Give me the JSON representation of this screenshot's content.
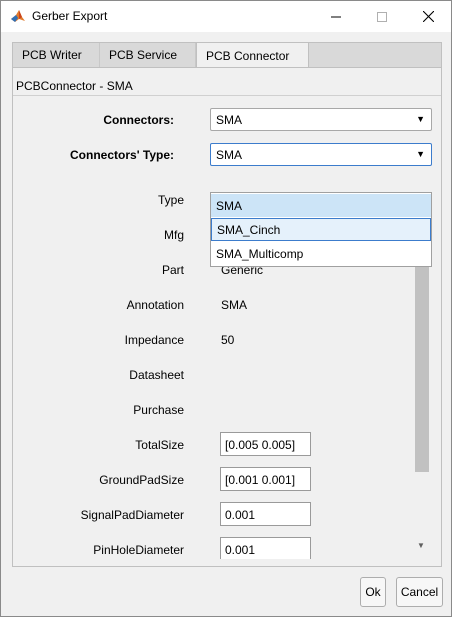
{
  "window": {
    "title": "Gerber Export",
    "minimize_glyph": "—",
    "maximize_glyph": "☐",
    "close_glyph": "✕"
  },
  "tabs": [
    {
      "label": "PCB Writer",
      "active": false
    },
    {
      "label": "PCB Service",
      "active": false
    },
    {
      "label": "PCB Connector",
      "active": true
    }
  ],
  "panel": {
    "title": "PCBConnector - SMA",
    "connectors_label": "Connectors:",
    "connectors_value": "SMA",
    "type_label": "Connectors' Type:",
    "type_value": "SMA",
    "type_options": [
      "SMA",
      "SMA_Cinch",
      "SMA_Multicomp"
    ],
    "properties": {
      "type_label": "Type",
      "mfg_label": "Mfg",
      "part_label": "Part",
      "part_value": "Generic",
      "annotation_label": "Annotation",
      "annotation_value": "SMA",
      "impedance_label": "Impedance",
      "impedance_value": "50",
      "datasheet_label": "Datasheet",
      "purchase_label": "Purchase",
      "totalsize_label": "TotalSize",
      "totalsize_value": "[0.005 0.005]",
      "groundpad_label": "GroundPadSize",
      "groundpad_value": "[0.001 0.001]",
      "signalpad_label": "SignalPadDiameter",
      "signalpad_value": "0.001",
      "pinhole_label": "PinHoleDiameter",
      "pinhole_value": "0.001"
    }
  },
  "buttons": {
    "ok": "Ok",
    "cancel": "Cancel"
  },
  "icons": {
    "dropdown_arrow": "▼",
    "scroll_down": "▼"
  },
  "colors": {
    "selected_option_bg": "#cce4f7",
    "hover_option_bg": "#e5f1fb",
    "focus_border": "#3c7ccc"
  }
}
